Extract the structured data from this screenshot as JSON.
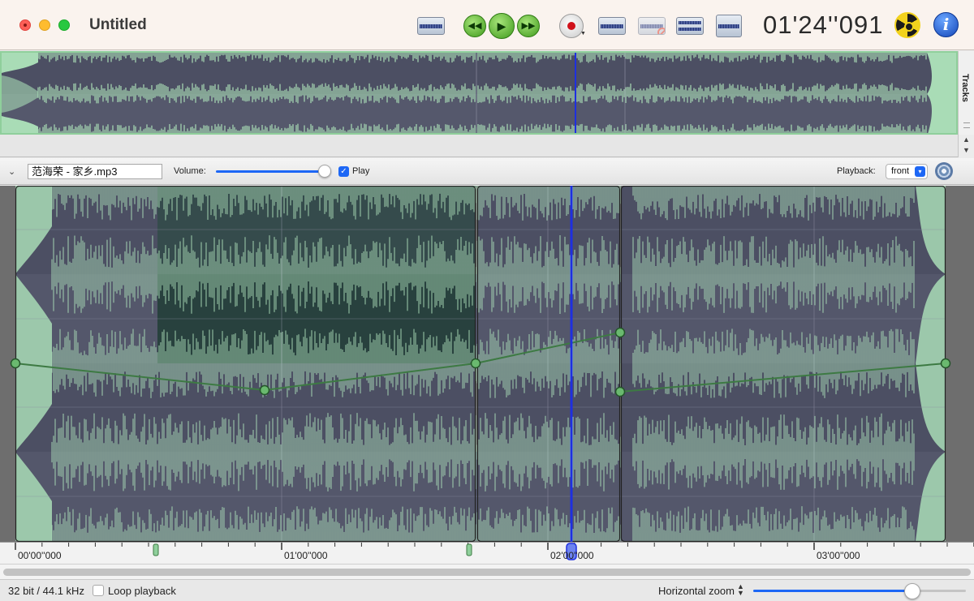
{
  "window": {
    "title": "Untitled"
  },
  "toolbar": {
    "buttons": [
      {
        "name": "waveform-view",
        "icon": "waveform-icon"
      },
      {
        "name": "rewind",
        "icon": "rewind-icon",
        "glyph": "◀◀"
      },
      {
        "name": "play",
        "icon": "play-icon",
        "glyph": "▶"
      },
      {
        "name": "fast-forward",
        "icon": "fast-forward-icon",
        "glyph": "▶▶"
      },
      {
        "name": "record",
        "icon": "record-icon"
      },
      {
        "name": "waveform-alt",
        "icon": "waveform-icon"
      },
      {
        "name": "no-waveform",
        "icon": "waveform-disabled-icon"
      },
      {
        "name": "equalizer",
        "icon": "equalizer-icon"
      },
      {
        "name": "export",
        "icon": "export-icon"
      }
    ],
    "time_display": "01'24''091",
    "accent_play": "#3f9a1c",
    "record_color": "#d0121b",
    "info_glyph": "i"
  },
  "side": {
    "tracks_label": "Tracks"
  },
  "track": {
    "file_name": "范海荣 - 家乡.mp3",
    "volume_label": "Volume:",
    "volume_level": 1.0,
    "play_checked": true,
    "play_label": "Play",
    "playback_label": "Playback:",
    "playback_value": "front",
    "wave_color": "#a9dcb6",
    "background_color": "#4c4f63",
    "playhead_color": "#1e2fe0",
    "check_glyph": "✓",
    "select_glyph": "⌃⌄",
    "collapse_glyph": "⌄"
  },
  "ruler": {
    "labels": [
      "00'00''000",
      "01'00''000",
      "02'00''000",
      "03'00''000"
    ]
  },
  "status": {
    "format": "32 bit / 44.1 kHz",
    "loop_label": "Loop playback",
    "loop_checked": false,
    "zoom_label": "Horizontal zoom",
    "zoom_arrows": "▲▼",
    "zoom_level": 0.75
  }
}
